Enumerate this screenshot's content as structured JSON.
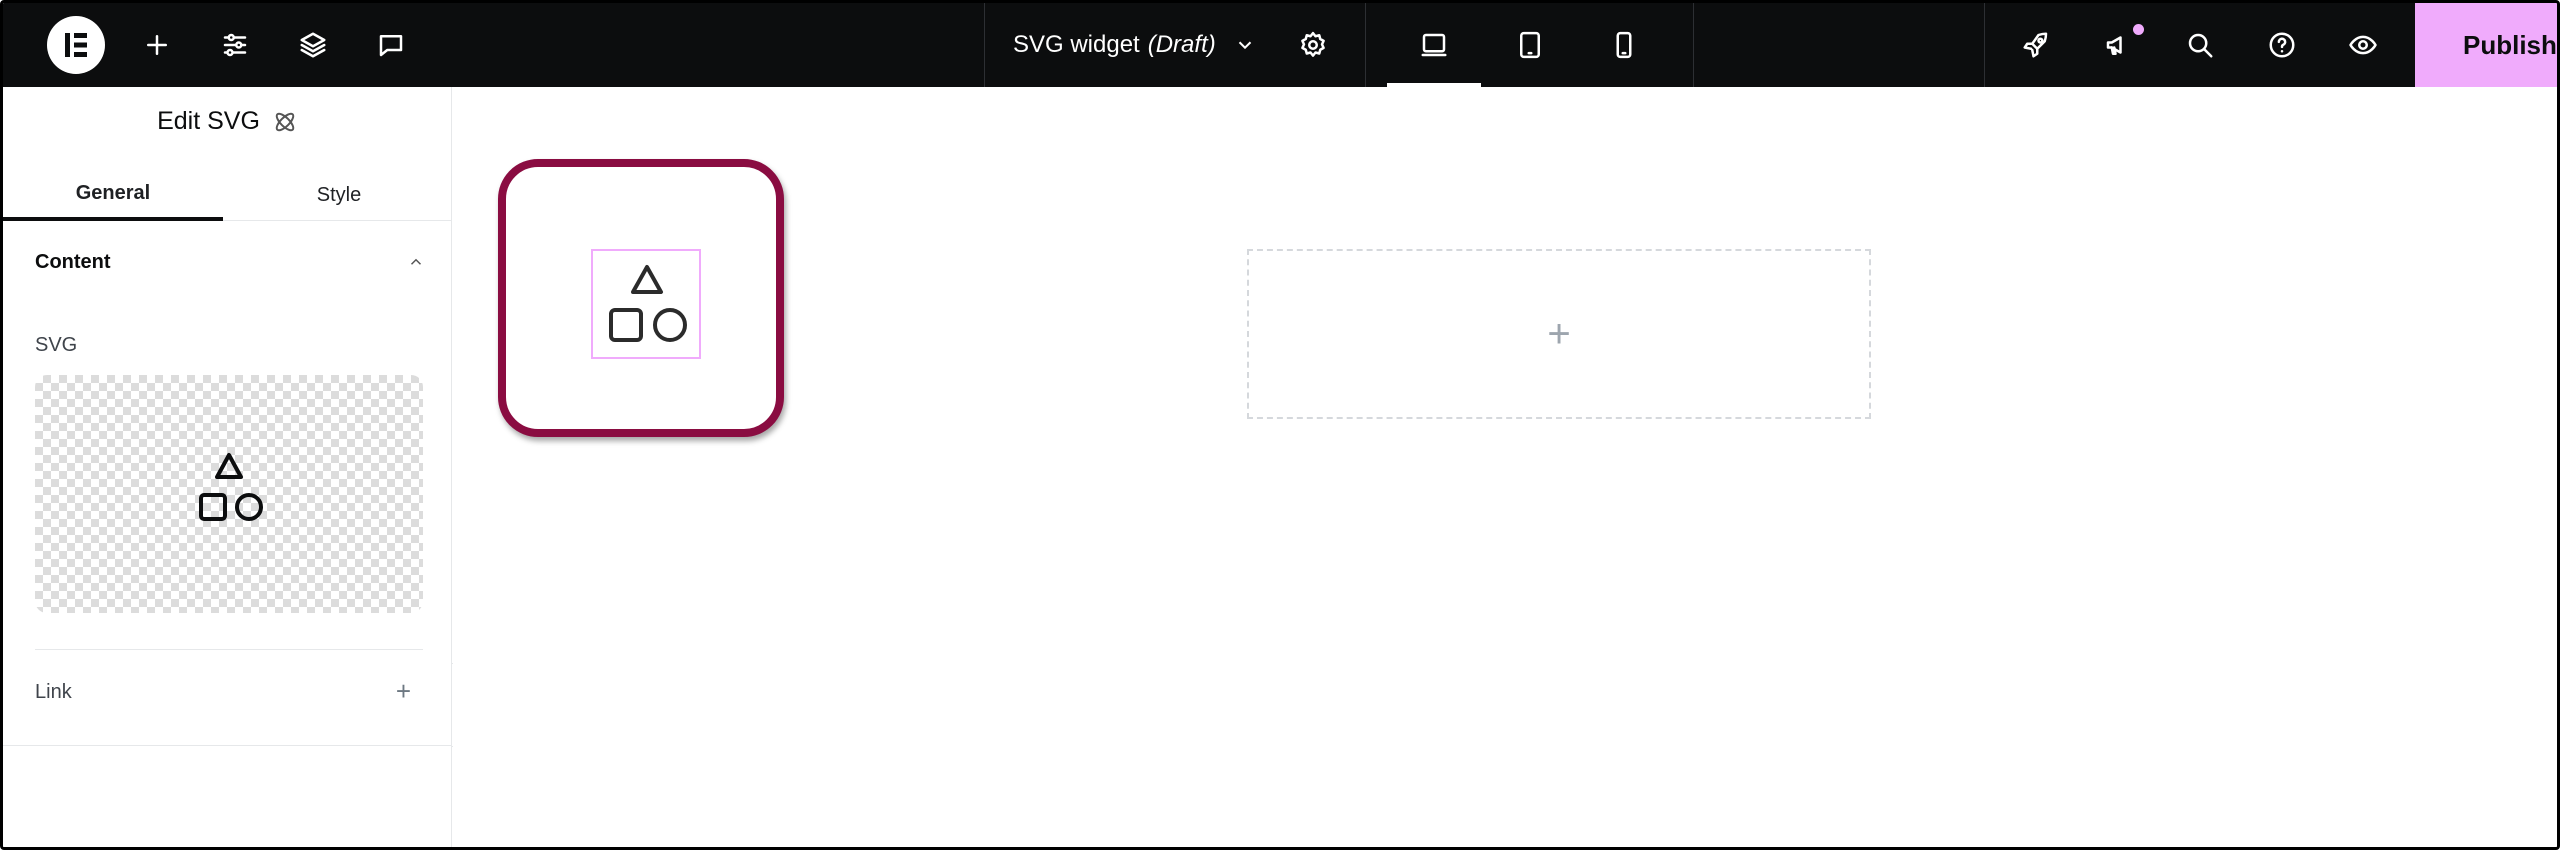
{
  "topbar": {
    "logo_icon": "elementor-logo-icon",
    "left_tools": [
      {
        "name": "add-element-icon"
      },
      {
        "name": "site-settings-icon"
      },
      {
        "name": "structure-icon"
      },
      {
        "name": "comments-icon"
      }
    ],
    "document": {
      "title": "SVG widget",
      "status": "(Draft)"
    },
    "devices": [
      "desktop",
      "tablet",
      "mobile"
    ],
    "right_tools": [
      {
        "name": "rocket-icon"
      },
      {
        "name": "whats-new-icon"
      },
      {
        "name": "search-icon"
      },
      {
        "name": "help-icon"
      },
      {
        "name": "preview-icon"
      }
    ],
    "publish_label": "Publish",
    "accent_color": "#f0abfc"
  },
  "panel": {
    "title": "Edit SVG",
    "tabs": [
      {
        "label": "General",
        "active": true
      },
      {
        "label": "Style",
        "active": false
      }
    ],
    "section": {
      "label": "Content",
      "expanded": true
    },
    "svg_field_label": "SVG",
    "link_label": "Link"
  },
  "canvas": {
    "frame_color": "#8a0c41"
  }
}
